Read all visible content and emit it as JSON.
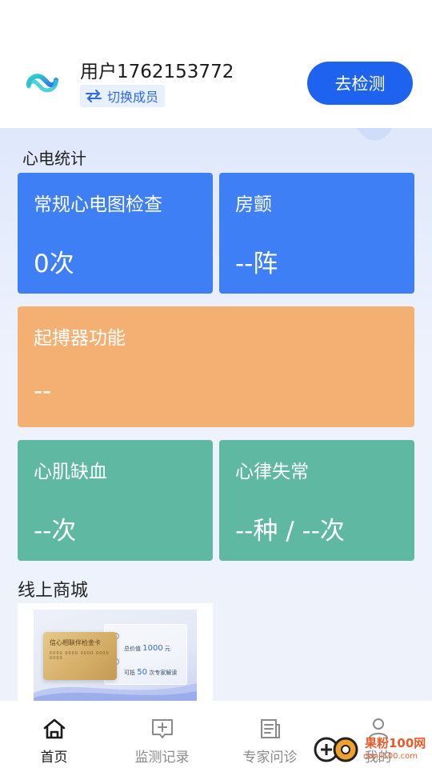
{
  "header": {
    "username": "用户1762153772",
    "switch_member_label": "切换成员",
    "detect_button_label": "去检测"
  },
  "ecg_stats": {
    "section_title": "心电统计",
    "cards": [
      {
        "title": "常规心电图检查",
        "value": "0次",
        "color": "#3f7ff5"
      },
      {
        "title": "房颤",
        "value": "--阵",
        "color": "#3f7ff5"
      },
      {
        "title": "起搏器功能",
        "value": "--",
        "color": "#f4b072"
      },
      {
        "title": "心肌缺血",
        "value": "--次",
        "color": "#5fb8a2"
      },
      {
        "title": "心律失常",
        "value": "--种 / --次",
        "color": "#5fb8a2"
      }
    ]
  },
  "shop": {
    "section_title": "线上商城",
    "product": {
      "card_title": "信心相联伴检金卡",
      "card_number": "0000 0000 0000 0000 0000",
      "total_label": "总价值",
      "total_value": "1000",
      "total_unit": "元",
      "offset_label": "可抵",
      "offset_value": "50",
      "offset_suffix": "次专家解读"
    }
  },
  "tabbar": {
    "items": [
      {
        "label": "首页",
        "icon": "home-icon",
        "active": true
      },
      {
        "label": "监测记录",
        "icon": "monitor-record-icon",
        "active": false
      },
      {
        "label": "专家问诊",
        "icon": "expert-consult-icon",
        "active": false
      },
      {
        "label": "我的",
        "icon": "profile-icon",
        "active": false
      }
    ]
  },
  "watermark": {
    "brand": "果粉100网",
    "url": "danji100.com"
  },
  "colors": {
    "primary": "#1e63f0",
    "card_blue": "#3f7ff5",
    "card_orange": "#f4b072",
    "card_green": "#5fb8a2"
  }
}
